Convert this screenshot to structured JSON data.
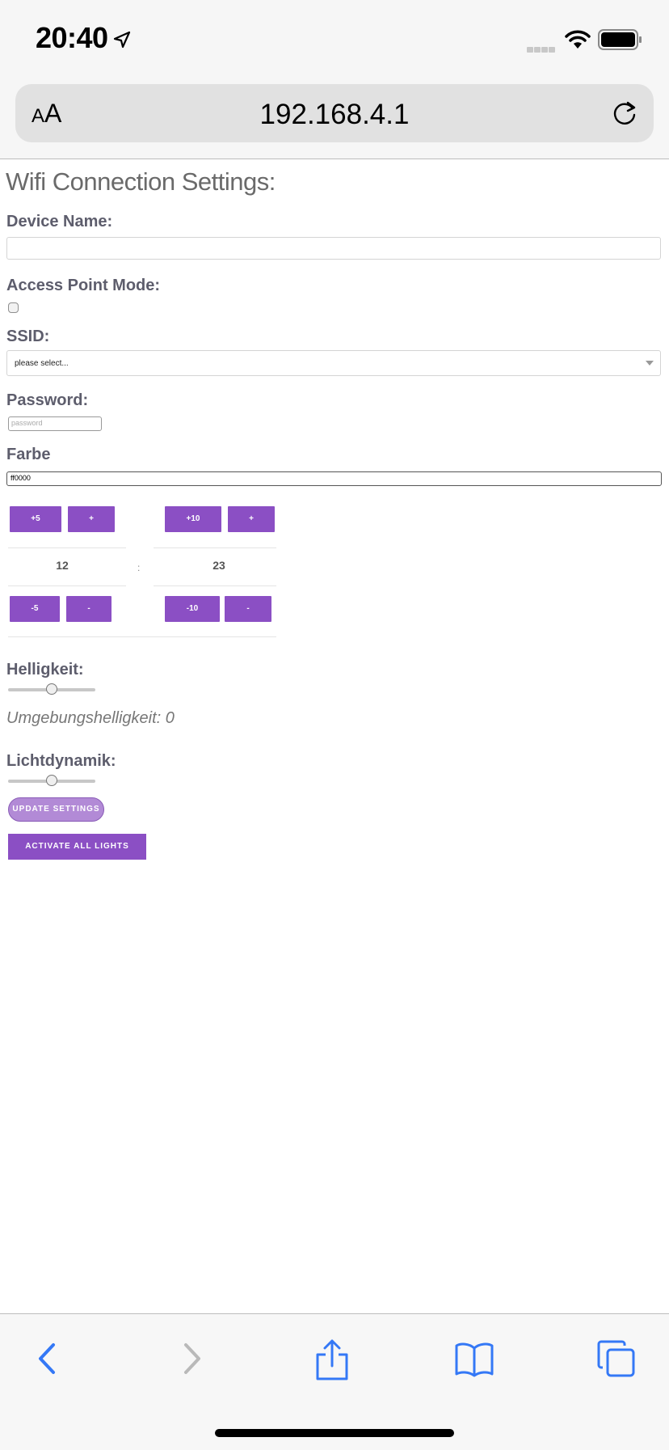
{
  "status_bar": {
    "time": "20:40",
    "location_icon": "location-arrow-icon",
    "wifi_icon": "wifi-icon",
    "battery_icon": "battery-icon"
  },
  "address_bar": {
    "text_size_label": "AA",
    "url": "192.168.4.1",
    "reload_icon": "reload-icon"
  },
  "form": {
    "heading": "Wifi Connection Settings:",
    "device_name_label": "Device Name:",
    "device_name_value": "",
    "ap_mode_label": "Access Point Mode:",
    "ap_mode_checked": false,
    "ssid_label": "SSID:",
    "ssid_selected": "please select...",
    "password_label": "Password:",
    "password_placeholder": "password",
    "color_label": "Farbe",
    "color_value": "ff0000"
  },
  "time_picker": {
    "hours_up_big": "+5",
    "hours_up": "+",
    "minutes_up_big": "+10",
    "minutes_up": "+",
    "hours": "12",
    "separator": ":",
    "minutes": "23",
    "hours_down_big": "-5",
    "hours_down": "-",
    "minutes_down_big": "-10",
    "minutes_down": "-"
  },
  "brightness": {
    "label": "Helligkeit:",
    "level": 0.5,
    "ambient_text": "Umgebungshelligkeit: 0"
  },
  "dynamics": {
    "label": "Lichtdynamik:",
    "level": 0.5
  },
  "buttons": {
    "update_settings": "UPDATE SETTINGS",
    "activate_all_lights": "ACTIVATE ALL LIGHTS"
  },
  "toolbar": {
    "icons": [
      "back-icon",
      "forward-icon",
      "share-icon",
      "bookmarks-icon",
      "tabs-icon"
    ]
  },
  "colors": {
    "accent": "#8b4fc4",
    "ios_blue": "#3478f6"
  }
}
